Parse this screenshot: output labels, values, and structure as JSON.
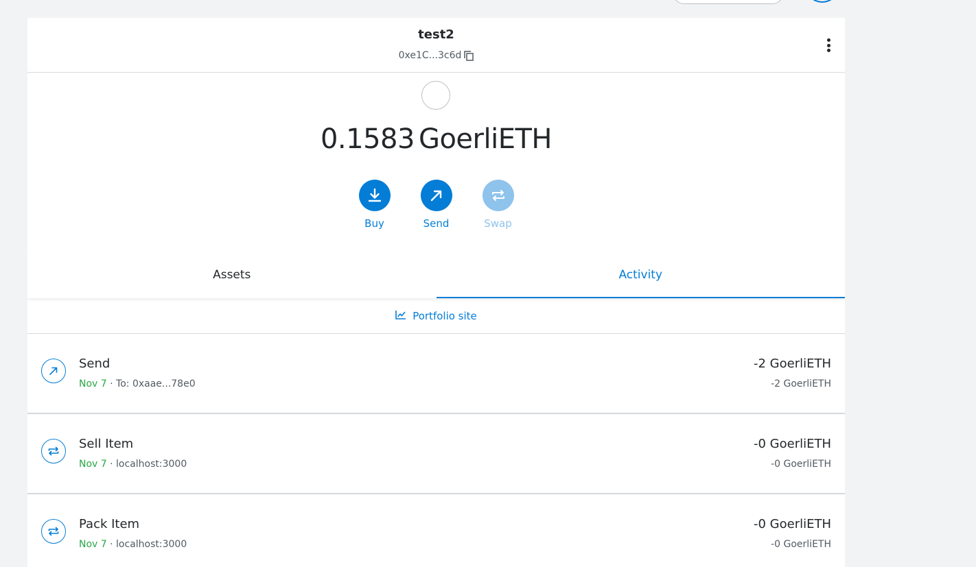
{
  "colors": {
    "primary": "#037dd6",
    "primary_disabled": "#8ec3ec",
    "confirmed": "#28a745",
    "text": "#24272a",
    "muted": "#535a61",
    "background": "#f2f3f4"
  },
  "account": {
    "name": "test2",
    "address": "0xe1C...3c6d"
  },
  "balance": {
    "amount": "0.1583",
    "symbol": "GoerliETH"
  },
  "actions": [
    {
      "label": "Buy",
      "icon": "download-icon",
      "enabled": true
    },
    {
      "label": "Send",
      "icon": "arrow-up-right-icon",
      "enabled": true
    },
    {
      "label": "Swap",
      "icon": "swap-icon",
      "enabled": false
    }
  ],
  "tabs": [
    {
      "label": "Assets",
      "active": false
    },
    {
      "label": "Activity",
      "active": true
    }
  ],
  "portfolio": {
    "label": "Portfolio site",
    "icon": "chart-line-icon"
  },
  "transactions": [
    {
      "title": "Send",
      "date": "Nov 7",
      "separator": "·",
      "detail": "To: 0xaae...78e0",
      "amount": "-2 GoerliETH",
      "secondary_amount": "-2 GoerliETH",
      "icon": "arrow-up-right-icon"
    },
    {
      "title": "Sell Item",
      "date": "Nov 7",
      "separator": "·",
      "detail": "localhost:3000",
      "amount": "-0 GoerliETH",
      "secondary_amount": "-0 GoerliETH",
      "icon": "swap-icon"
    },
    {
      "title": "Pack Item",
      "date": "Nov 7",
      "separator": "·",
      "detail": "localhost:3000",
      "amount": "-0 GoerliETH",
      "secondary_amount": "-0 GoerliETH",
      "icon": "swap-icon"
    }
  ]
}
